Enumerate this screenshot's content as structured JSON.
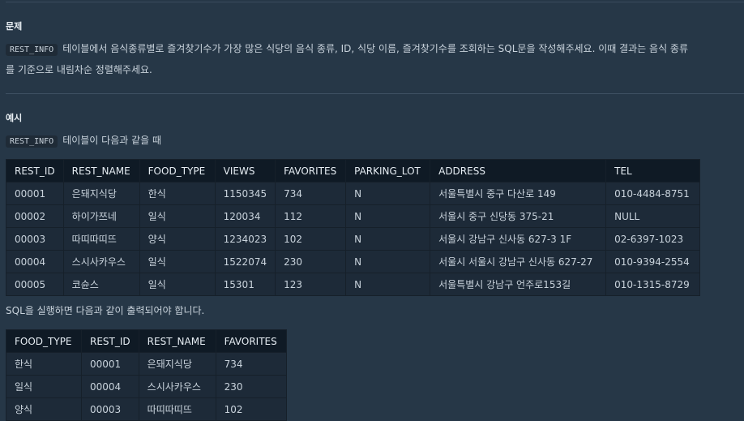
{
  "problem": {
    "heading": "문제",
    "table_code": "REST_INFO",
    "text_line1": "테이블에서 음식종류별로 즐겨찾기수가 가장 많은 식당의 음식 종류, ID, 식당 이름, 즐겨찾기수를 조회하는 SQL문을 작성해주세요. 이때 결과는 음식 종류",
    "text_line2": "를 기준으로 내림차순 정렬해주세요."
  },
  "example": {
    "heading": "예시",
    "table_code": "REST_INFO",
    "intro": "테이블이 다음과 같을 때",
    "result_intro": "SQL을 실행하면 다음과 같이 출력되어야 합니다."
  },
  "rest_info": {
    "columns": [
      "REST_ID",
      "REST_NAME",
      "FOOD_TYPE",
      "VIEWS",
      "FAVORITES",
      "PARKING_LOT",
      "ADDRESS",
      "TEL"
    ],
    "rows": [
      [
        "00001",
        "은돼지식당",
        "한식",
        "1150345",
        "734",
        "N",
        "서울특별시 중구 다산로 149",
        "010-4484-8751"
      ],
      [
        "00002",
        "하이가쯔네",
        "일식",
        "120034",
        "112",
        "N",
        "서울시 중구 신당동 375-21",
        "NULL"
      ],
      [
        "00003",
        "따띠따띠뜨",
        "양식",
        "1234023",
        "102",
        "N",
        "서울시 강남구 신사동 627-3 1F",
        "02-6397-1023"
      ],
      [
        "00004",
        "스시사카우스",
        "일식",
        "1522074",
        "230",
        "N",
        "서울시 서울시 강남구 신사동 627-27",
        "010-9394-2554"
      ],
      [
        "00005",
        "코슌스",
        "일식",
        "15301",
        "123",
        "N",
        "서울특별시 강남구 언주로153길",
        "010-1315-8729"
      ]
    ]
  },
  "result": {
    "columns": [
      "FOOD_TYPE",
      "REST_ID",
      "REST_NAME",
      "FAVORITES"
    ],
    "rows": [
      [
        "한식",
        "00001",
        "은돼지식당",
        "734"
      ],
      [
        "일식",
        "00004",
        "스시사카우스",
        "230"
      ],
      [
        "양식",
        "00003",
        "따띠따띠뜨",
        "102"
      ]
    ]
  }
}
